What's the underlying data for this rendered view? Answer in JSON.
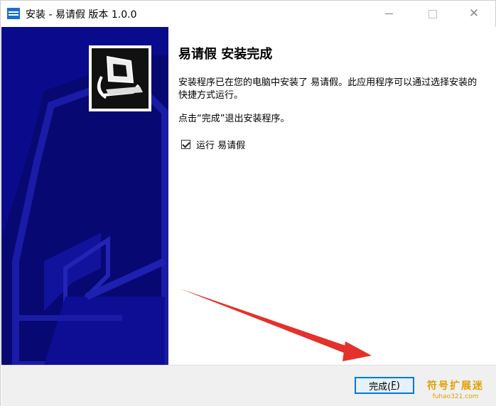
{
  "window": {
    "title": "安装 - 易请假 版本 1.0.0",
    "minimize_icon": "minimize-icon",
    "maximize_icon": "maximize-icon",
    "close_icon": "close-icon",
    "close_glyph": "✕"
  },
  "colors": {
    "banner": "#0a0b8c",
    "accent": "#0078d7",
    "arrow": "#e5312b",
    "watermark": "#e0a000"
  },
  "page": {
    "heading": "易请假 安装完成",
    "message": "安装程序已在您的电脑中安装了 易请假。此应用程序可以通过选择安装的快捷方式运行。",
    "instruction": "点击“完成”退出安装程序。",
    "run_checkbox": {
      "label": "运行 易请假",
      "checked": true
    }
  },
  "footer": {
    "finish_prefix": "完成(",
    "finish_hotkey": "F",
    "finish_suffix": ")"
  },
  "watermark": {
    "text_cn": "符号扩展迷",
    "text_en": "fuhao321.com"
  }
}
